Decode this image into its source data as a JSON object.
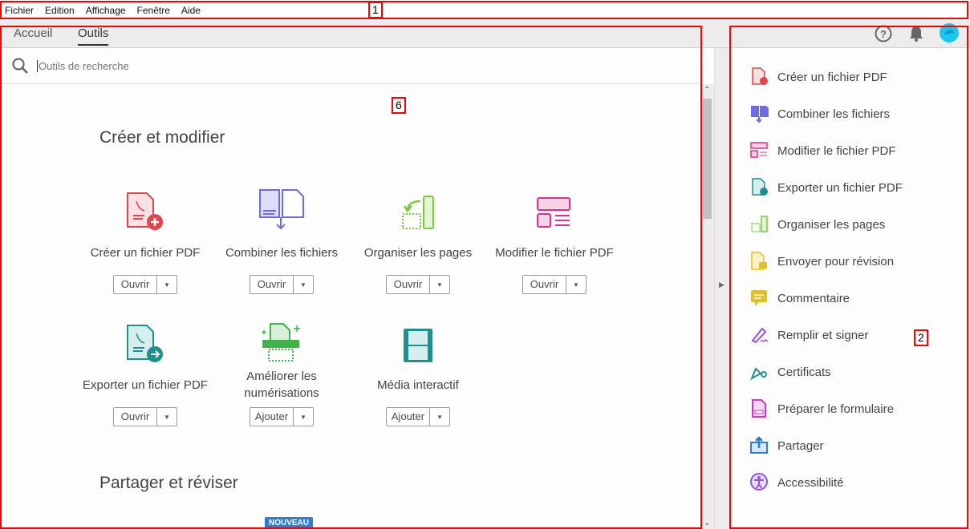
{
  "menu": [
    "Fichier",
    "Edition",
    "Affichage",
    "Fenêtre",
    "Aide"
  ],
  "tabs": [
    {
      "label": "Accueil",
      "active": false
    },
    {
      "label": "Outils",
      "active": true
    }
  ],
  "search": {
    "placeholder": "Outils de recherche"
  },
  "sections": [
    {
      "title": "Créer et modifier"
    },
    {
      "title": "Partager et réviser"
    }
  ],
  "tools": [
    {
      "label": "Créer un fichier PDF",
      "button": "Ouvrir",
      "icon": "create-pdf-icon",
      "color": "#e0454f"
    },
    {
      "label": "Combiner les fichiers",
      "button": "Ouvrir",
      "icon": "combine-files-icon",
      "color": "#6d6de3"
    },
    {
      "label": "Organiser les pages",
      "button": "Ouvrir",
      "icon": "organize-pages-icon",
      "color": "#78c93a"
    },
    {
      "label": "Modifier le fichier PDF",
      "button": "Ouvrir",
      "icon": "edit-pdf-icon",
      "color": "#d8318f"
    },
    {
      "label": "Exporter un fichier PDF",
      "button": "Ouvrir",
      "icon": "export-pdf-icon",
      "color": "#1f8f8f"
    },
    {
      "label": "Améliorer les numérisations",
      "button": "Ajouter",
      "icon": "enhance-scans-icon",
      "color": "#3fb24a"
    },
    {
      "label": "Média interactif",
      "button": "Ajouter",
      "icon": "rich-media-icon",
      "color": "#1f8f8f"
    }
  ],
  "badge": "NOUVEAU",
  "right_panel": [
    {
      "label": "Créer un fichier PDF",
      "color": "#e0454f"
    },
    {
      "label": "Combiner les fichiers",
      "color": "#6d6de3"
    },
    {
      "label": "Modifier le fichier PDF",
      "color": "#d8318f"
    },
    {
      "label": "Exporter un fichier PDF",
      "color": "#1f8f8f"
    },
    {
      "label": "Organiser les pages",
      "color": "#78c93a"
    },
    {
      "label": "Envoyer pour révision",
      "color": "#e2c02a"
    },
    {
      "label": "Commentaire",
      "color": "#e2c02a"
    },
    {
      "label": "Remplir et signer",
      "color": "#9255d6"
    },
    {
      "label": "Certificats",
      "color": "#1f8f8f"
    },
    {
      "label": "Préparer le formulaire",
      "color": "#c93ac9"
    },
    {
      "label": "Partager",
      "color": "#2d7fd3"
    },
    {
      "label": "Accessibilité",
      "color": "#9255d6"
    }
  ],
  "annotations": [
    "1",
    "2",
    "6"
  ]
}
